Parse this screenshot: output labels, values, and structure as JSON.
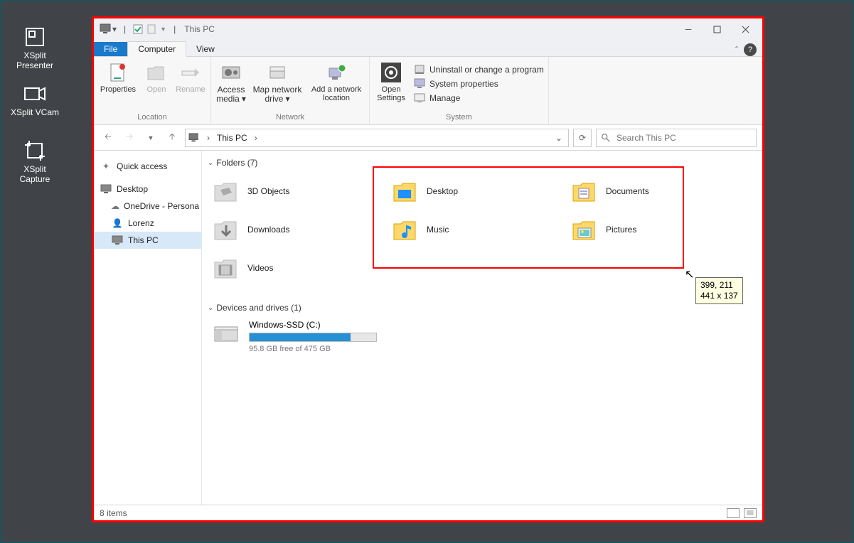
{
  "desktop_icons": [
    {
      "label": "XSplit Presenter"
    },
    {
      "label": "XSplit VCam"
    },
    {
      "label": "XSplit Capture"
    }
  ],
  "window": {
    "title": "This PC"
  },
  "tabs": {
    "file": "File",
    "computer": "Computer",
    "view": "View"
  },
  "ribbon": {
    "location": {
      "title": "Location",
      "properties": "Properties",
      "open": "Open",
      "rename": "Rename"
    },
    "network": {
      "title": "Network",
      "access": "Access media",
      "map": "Map network drive",
      "add": "Add a network location"
    },
    "system": {
      "title": "System",
      "open_settings": "Open Settings",
      "uninstall": "Uninstall or change a program",
      "sysprops": "System properties",
      "manage": "Manage"
    }
  },
  "address": {
    "crumb": "This PC",
    "search_placeholder": "Search This PC"
  },
  "nav": {
    "quick": "Quick access",
    "desktop": "Desktop",
    "onedrive": "OneDrive - Persona",
    "user": "Lorenz",
    "thispc": "This PC"
  },
  "sections": {
    "folders": "Folders (7)",
    "drives": "Devices and drives (1)"
  },
  "folders": [
    {
      "name": "3D Objects"
    },
    {
      "name": "Desktop"
    },
    {
      "name": "Documents"
    },
    {
      "name": "Downloads"
    },
    {
      "name": "Music"
    },
    {
      "name": "Pictures"
    },
    {
      "name": "Videos"
    }
  ],
  "drive": {
    "name": "Windows-SSD (C:)",
    "free": "95.8 GB free of 475 GB",
    "used_pct": 80
  },
  "status": {
    "items": "8 items"
  },
  "tooltip": {
    "line1": "399, 211",
    "line2": "441 x 137"
  }
}
